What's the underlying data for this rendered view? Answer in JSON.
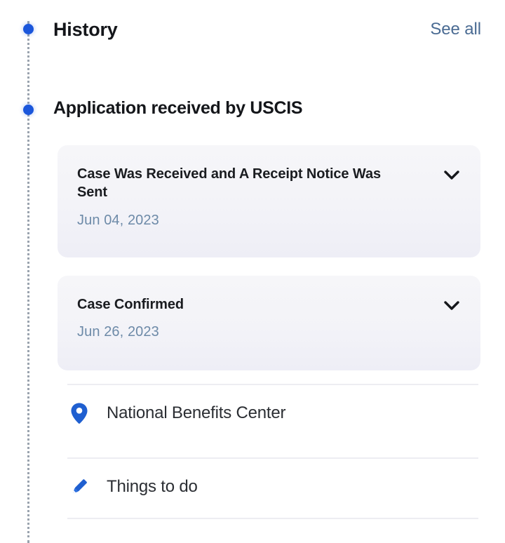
{
  "theme": {
    "accent_blue": "#1a56db",
    "icon_blue": "#1f5fd0",
    "link_blue": "#4a6b93",
    "date_blue": "#6d8aa8",
    "card_bg": "#f3f3f8",
    "divider": "#ededf2",
    "text_dark": "#14161a",
    "rail_gray": "#9aa3ae"
  },
  "header": {
    "title": "History",
    "see_all_label": "See all"
  },
  "stage": {
    "heading": "Application received by USCIS"
  },
  "events": [
    {
      "title": "Case Was Received and A Receipt Notice Was Sent",
      "date": "Jun 04, 2023",
      "expand_icon": "chevron-down-icon"
    },
    {
      "title": "Case Confirmed",
      "date": "Jun 26, 2023",
      "expand_icon": "chevron-down-icon"
    }
  ],
  "list_rows": [
    {
      "icon": "map-pin-icon",
      "label": "National Benefits Center"
    },
    {
      "icon": "pencil-icon",
      "label": "Things to do"
    }
  ]
}
